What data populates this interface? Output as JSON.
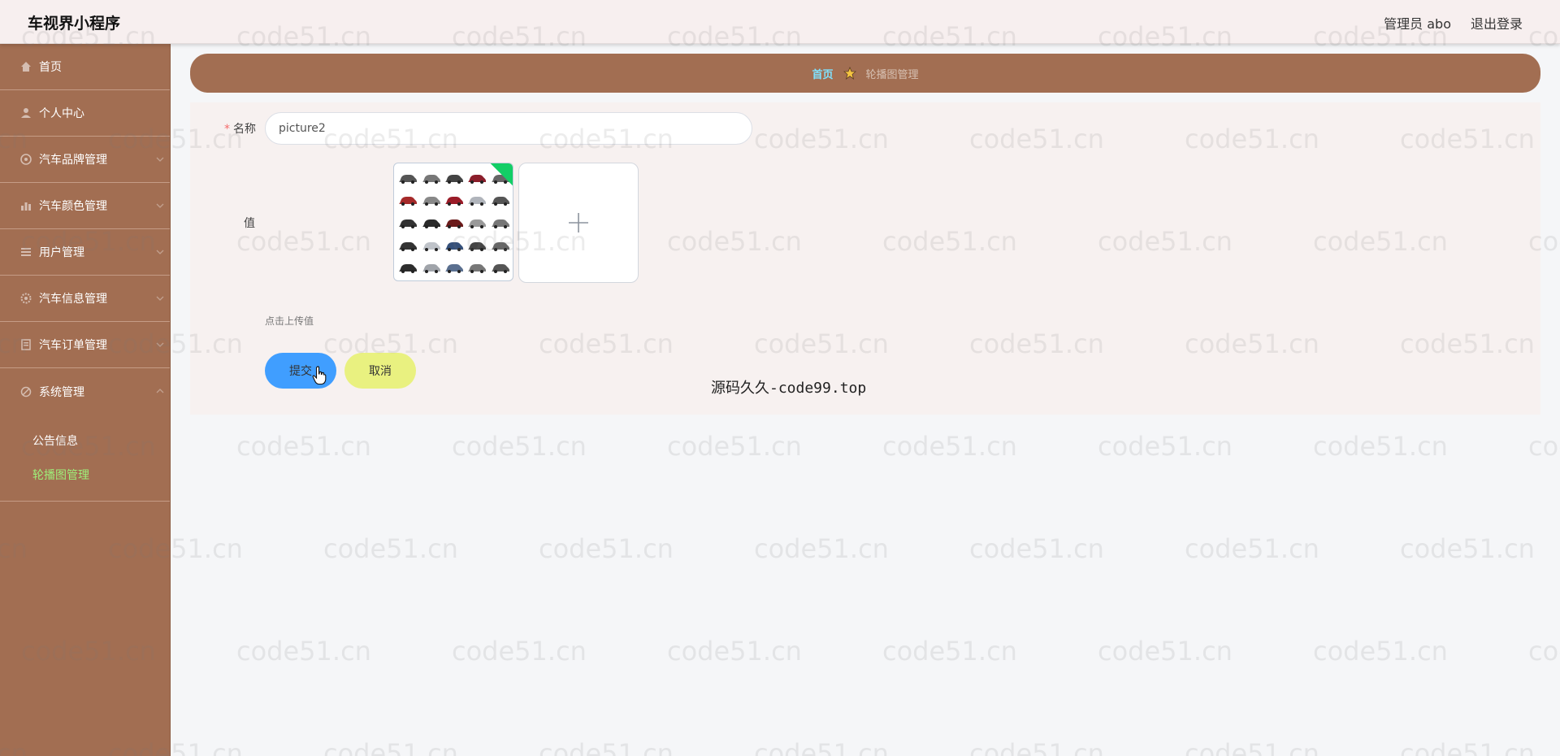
{
  "header": {
    "app_title": "车视界小程序",
    "user_info": "管理员 abo",
    "logout_label": "退出登录"
  },
  "sidebar": {
    "items": [
      {
        "label": "首页",
        "icon": "home-icon"
      },
      {
        "label": "个人中心",
        "icon": "user-icon"
      },
      {
        "label": "汽车品牌管理",
        "icon": "brand-icon"
      },
      {
        "label": "汽车颜色管理",
        "icon": "bar-chart-icon"
      },
      {
        "label": "用户管理",
        "icon": "list-icon"
      },
      {
        "label": "汽车信息管理",
        "icon": "gear-icon"
      },
      {
        "label": "汽车订单管理",
        "icon": "order-icon"
      },
      {
        "label": "系统管理",
        "icon": "system-icon"
      }
    ],
    "sub_items": [
      {
        "label": "公告信息",
        "active": false
      },
      {
        "label": "轮播图管理",
        "active": true
      }
    ]
  },
  "breadcrumb": {
    "home": "首页",
    "current": "轮播图管理"
  },
  "form": {
    "name_label": "名称",
    "name_value": "picture2",
    "value_label": "值",
    "upload_tip": "点击上传值",
    "submit_label": "提交",
    "cancel_label": "取消"
  },
  "overlay_text": "源码久久-code99.top",
  "watermark_text": "code51.cn",
  "colors": {
    "sidebar": "#a26e52",
    "accent_blue": "#409eff",
    "cancel_yellow": "#e9f180",
    "active_green": "#9ef07a",
    "breadcrumb_home": "#7fe2ff",
    "success_corner": "#13ce66"
  }
}
